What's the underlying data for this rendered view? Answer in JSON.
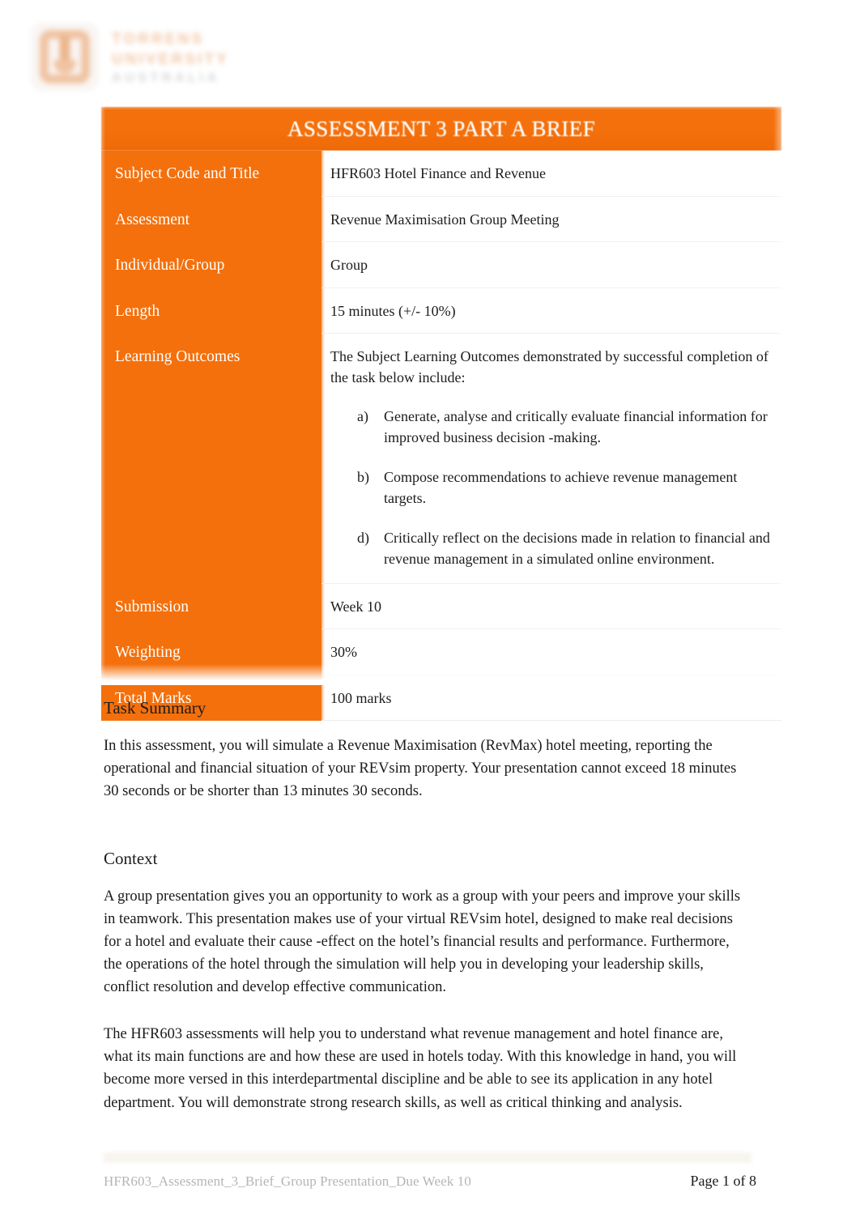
{
  "masthead": {
    "logo_icon": "torrens-university-logo",
    "wordmark_line1": "TORRENS",
    "wordmark_line2": "UNIVERSITY",
    "wordmark_line3": "AUSTRALIA"
  },
  "brief": {
    "title": "ASSESSMENT 3 PART A BRIEF",
    "rows": [
      {
        "label": "Subject Code and Title",
        "value": "HFR603 Hotel Finance and Revenue"
      },
      {
        "label": "Assessment",
        "value": "Revenue Maximisation Group Meeting"
      },
      {
        "label": "Individual/Group",
        "value": "Group"
      },
      {
        "label": "Length",
        "value": "15 minutes (+/- 10%)"
      }
    ],
    "learning_outcomes": {
      "label": "Learning Outcomes",
      "intro": "The Subject Learning Outcomes demonstrated by successful completion of the task below include:",
      "items": [
        {
          "marker": "a)",
          "text": "Generate, analyse and critically evaluate financial information for improved business decision  -making."
        },
        {
          "marker": "b)",
          "text": "Compose recommendations to achieve revenue management targets."
        },
        {
          "marker": "d)",
          "text": "Critically reflect on the decisions made in relation to financial and revenue management in a simulated online environment."
        }
      ]
    },
    "rows_after": [
      {
        "label": "Submission",
        "value": "Week 10"
      },
      {
        "label": "Weighting",
        "value": "30%"
      },
      {
        "label": "Total Marks",
        "value": "100 marks"
      }
    ]
  },
  "sections": {
    "task_summary": {
      "heading": "Task Summary",
      "paragraph": "In this assessment, you will simulate a Revenue Maximisation (RevMax) hotel meeting, reporting the operational and financial situation of your REVsim property. Your presentation cannot exceed 18 minutes 30 seconds or be shorter than 13 minutes 30 seconds."
    },
    "context": {
      "heading": "Context",
      "paragraph1": "A group presentation gives you an opportunity to work as a group with your peers and improve your skills in teamwork. This presentation makes use of your virtual REVsim hotel, designed to make real decisions for a hotel and evaluate their cause  -effect on the hotel’s financial results and performance. Furthermore, the operations of the hotel through the simulation will help you in developing your leadership skills, conflict resolution and develop effective communication.",
      "paragraph2": "The HFR603 assessments will help you to understand what revenue management and hotel finance are, what its main functions are and how these are used in hotels today. With this knowledge in hand, you will become more versed in this interdepartmental discipline and be able to see its application in any hotel department. You will demonstrate strong research skills, as well as critical thinking and analysis."
    }
  },
  "footer": {
    "document_id": "HFR603_Assessment_3_Brief_Group Presentation_Due Week 10",
    "page_number": "Page 1 of 8"
  },
  "colors": {
    "brand_orange": "#F4700C",
    "header_text": "#FFFFFF",
    "body_text": "#1A1A1A",
    "footer_muted": "#B7B5B2"
  }
}
